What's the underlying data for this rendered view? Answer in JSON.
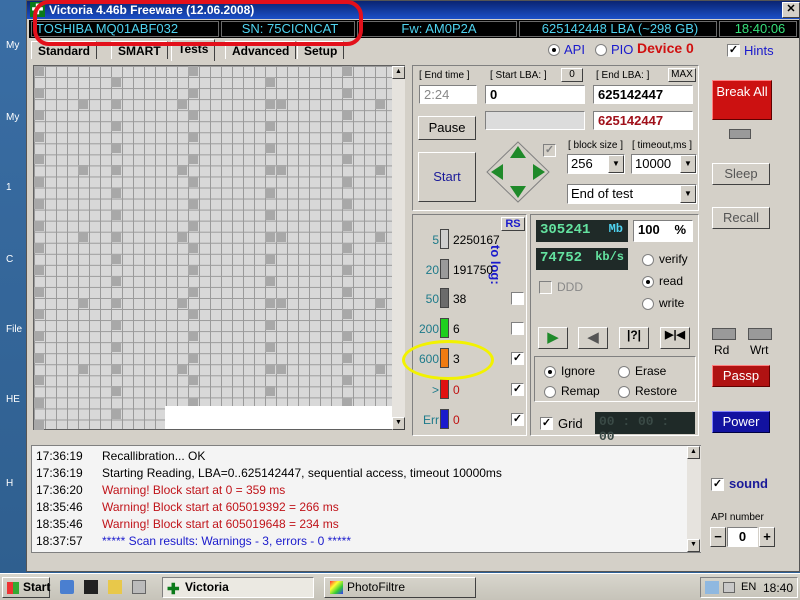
{
  "window": {
    "title": "Victoria 4.46b Freeware (12.06.2008)",
    "close_glyph": "✕",
    "minimize_glyph": "_",
    "maximize_glyph": "□"
  },
  "desktop_labels": [
    "My",
    "My",
    "1",
    "C",
    "File",
    "HE",
    "H"
  ],
  "infobar": {
    "model": "TOSHIBA MQ01ABF032",
    "serial": "SN: 75CICNCAT",
    "firmware": "Fw: AM0P2A",
    "lba": "625142448 LBA (~298 GB)",
    "time": "18:40:06"
  },
  "tabs": [
    "Standard",
    "SMART",
    "Tests",
    "Advanced",
    "Setup"
  ],
  "mode": {
    "api": "API",
    "pio": "PIO",
    "device": "Device 0",
    "hints": "Hints"
  },
  "controls": {
    "end_time_label": "[ End time ]",
    "end_time": "2:24",
    "start_lba_label": "[ Start LBA: ]",
    "start_lba_zero": "0",
    "start_lba": "0",
    "start_lba_2": "",
    "end_lba_label": "[ End LBA: ]",
    "end_lba_max": "MAX",
    "end_lba": "625142447",
    "end_lba_2": "625142447",
    "pause": "Pause",
    "start": "Start",
    "block_size_label": "[ block size ]",
    "block_size": "256",
    "timeout_label": "[ timeout,ms ]",
    "timeout": "10000",
    "end_action": "End of test"
  },
  "stats": {
    "rs": "RS",
    "to_log": "to log:",
    "rows": [
      {
        "ms": "5",
        "count": "2250167",
        "color": "#cfcfcf"
      },
      {
        "ms": "20",
        "count": "191750",
        "color": "#9a9a9a"
      },
      {
        "ms": "50",
        "count": "38",
        "color": "#6b6b6b"
      },
      {
        "ms": "200",
        "count": "6",
        "color": "#1ed01e"
      },
      {
        "ms": "600",
        "count": "3",
        "color": "#f07b10"
      },
      {
        "ms": ">",
        "count": "0",
        "color": "#e01010"
      },
      {
        "ms": "Err",
        "count": "0",
        "color": "#1a1acc"
      }
    ]
  },
  "readout": {
    "mb": "305241",
    "mb_unit": "Mb",
    "percent": "100",
    "percent_unit": "%",
    "speed": "74752",
    "speed_unit": "kb/s",
    "ddd": "DDD",
    "verify": "verify",
    "read": "read",
    "write": "write",
    "ignore": "Ignore",
    "erase": "Erase",
    "remap": "Remap",
    "restore": "Restore",
    "grid": "Grid",
    "clock": "00 : 00 : 00",
    "play_icons": [
      "▶",
      "◀",
      "|?|",
      "▶|◀"
    ]
  },
  "right": {
    "break_all": "Break All",
    "sleep": "Sleep",
    "recall": "Recall",
    "rd": "Rd",
    "wrt": "Wrt",
    "passp": "Passp",
    "power": "Power",
    "sound": "sound",
    "api_number": "API number",
    "api_value": "0",
    "minus": "−",
    "plus": "+"
  },
  "log": [
    {
      "time": "17:36:19",
      "text": "Recallibration... OK",
      "color": "#000000"
    },
    {
      "time": "17:36:19",
      "text": "Starting Reading, LBA=0..625142447, sequential access, timeout 10000ms",
      "color": "#000000"
    },
    {
      "time": "17:36:20",
      "text": "Warning! Block start at 0 = 359 ms",
      "color": "#c0141a"
    },
    {
      "time": "18:35:46",
      "text": "Warning! Block start at 605019392 = 266 ms",
      "color": "#c0141a"
    },
    {
      "time": "18:35:46",
      "text": "Warning! Block start at 605019648 = 234 ms",
      "color": "#c0141a"
    },
    {
      "time": "18:37:57",
      "text": "***** Scan results: Warnings - 3, errors - 0 *****",
      "color": "#1a1acc"
    }
  ],
  "taskbar": {
    "start": "Start",
    "task1": "Victoria",
    "task2": "PhotoFiltre",
    "lang": "EN",
    "clock": "18:40"
  }
}
